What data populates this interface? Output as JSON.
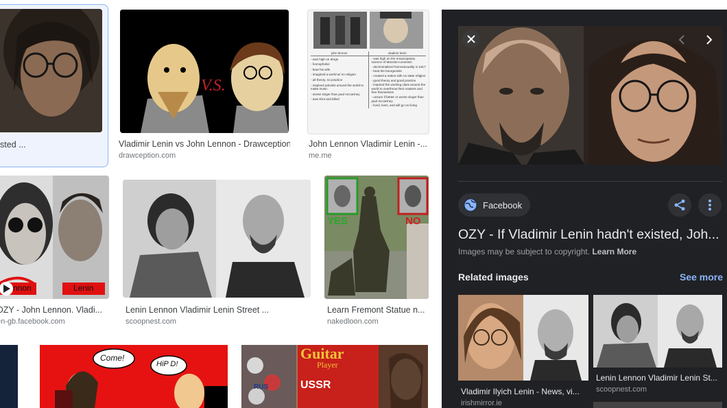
{
  "results": [
    {
      "title": "xisted ...",
      "source": ""
    },
    {
      "title": "Vladimir Lenin vs John Lennon - Drawception",
      "source": "drawception.com"
    },
    {
      "title": "John Lennon Vladimir Lenin -...",
      "source": "me.me"
    },
    {
      "title": "OZY - John Lennon. Vladi...",
      "source": "en-gb.facebook.com",
      "inner_labels": [
        "nnon",
        "Lenin"
      ]
    },
    {
      "title": "Lenin Lennon Vladimir Lenin Street ...",
      "source": "scoopnest.com"
    },
    {
      "title": "Learn Fremont Statue n...",
      "source": "nakedloon.com",
      "inner_labels": [
        "YES",
        "NO"
      ]
    }
  ],
  "thumb3_text": {
    "headers": [
      "john lennon",
      "vladimir lenin"
    ],
    "left": [
      "- was high on drugs",
      "- homophobic",
      "- beat his wife",
      "- imagined a world w/ no religion",
      "- all theory, no practice",
      "- inspired activists around the world to make music",
      "- worse singer than paul mccartney",
      "- was shot and killed"
    ],
    "right": [
      "- was high on the emancipatory science of Marxism-Leninism",
      "- decriminalized homosexuality in 1917",
      "- beat the bourgeoisie",
      "- created a nation with no state religion",
      "- good theory and good practice",
      "- inspired the working class around the world to overthrow their masters and free themselves",
      "- unsure if better or worse singer than paul mccartney",
      "- lived, lives, and will go on living"
    ]
  },
  "bottom_thumbs": {
    "comic1": [
      "Come!",
      "HiP D!"
    ],
    "magazine": [
      "Guitar",
      "Player",
      "USSR",
      "RUS"
    ]
  },
  "panel": {
    "source_name": "Facebook",
    "title": "OZY - If Vladimir Lenin hadn't existed, Joh...",
    "copyright": "Images may be subject to copyright.",
    "learn_more": "Learn More",
    "related_label": "Related images",
    "see_more": "See more",
    "related": [
      {
        "title": "Vladimir Ilyich Lenin - News, vi...",
        "source": "irishmirror.ie"
      },
      {
        "title": "Lenin Lennon Vladimir Lenin St...",
        "source": "scoopnest.com"
      }
    ]
  },
  "colors": {
    "panel_bg": "#202124",
    "accent_link": "#8ab4f8",
    "selected_border": "#8ab4f8",
    "selected_bg": "#eef3fd"
  },
  "icons": [
    "close-icon",
    "chevron-left-icon",
    "chevron-right-icon",
    "facebook-globe-icon",
    "share-icon",
    "more-vert-icon"
  ]
}
